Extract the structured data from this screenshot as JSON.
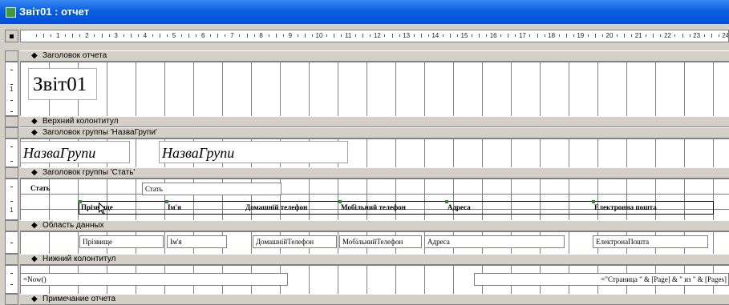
{
  "window": {
    "title": "Звіт01 : отчет"
  },
  "ruler": {
    "marks": [
      "1",
      "2",
      "3",
      "4",
      "5",
      "6",
      "7",
      "8",
      "9",
      "10",
      "11",
      "12",
      "13",
      "14",
      "15",
      "16",
      "17",
      "18",
      "19",
      "20",
      "21",
      "22",
      "23",
      "24"
    ]
  },
  "vruler": {
    "marks": [
      "1",
      "1"
    ]
  },
  "sections": {
    "report_header": "Заголовок отчета",
    "page_header": "Верхний колонтитул",
    "group_name_header": "Заголовок группы 'НазваГрупи'",
    "group_stat_header": "Заголовок группы 'Стать'",
    "detail": "Область данных",
    "page_footer": "Нижний колонтитул",
    "report_footer": "Примечание отчета"
  },
  "report_title": "Звіт01",
  "group_name": {
    "label": "НазваГрупи",
    "field": "НазваГрупи"
  },
  "group_stat": {
    "label": "Стать",
    "field": "Стать"
  },
  "column_labels": [
    "Прізвище",
    "Ім'я",
    "Домашній телефон",
    "Мобільний телефон",
    "Адреса",
    "Електронна пошта"
  ],
  "detail_fields": [
    "Прізвище",
    "Ім'я",
    "ДомашнійТелефон",
    "МобільнийТелефон",
    "Адреса",
    "ЕлектронаПошта"
  ],
  "footer": {
    "now": "=Now()",
    "pages": "=\"Страница \" & [Page] & \" из \" & [Pages]"
  }
}
